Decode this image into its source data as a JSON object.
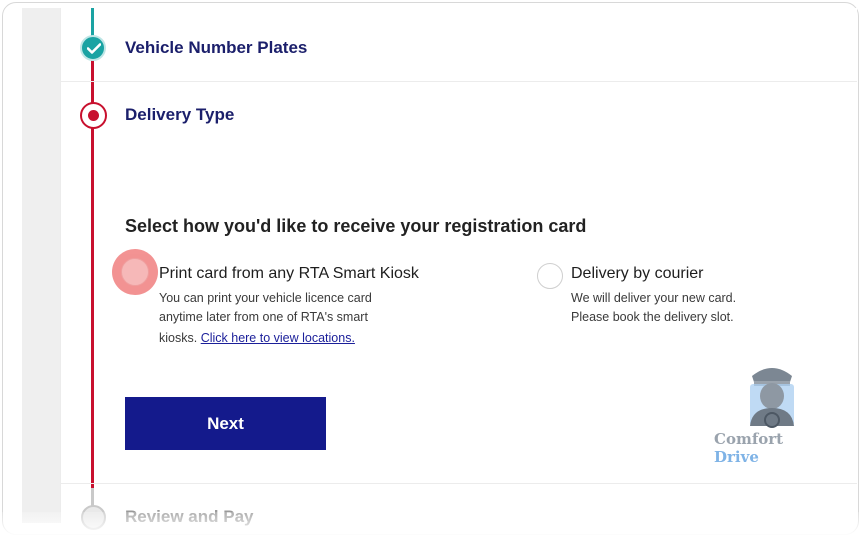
{
  "steps": {
    "completed": {
      "label": "Vehicle Number Plates",
      "icon": "check-icon"
    },
    "current": {
      "label": "Delivery Type"
    },
    "next": {
      "label": "Review and Pay"
    }
  },
  "delivery": {
    "question": "Select how you'd like to receive your registration card",
    "options": [
      {
        "title": "Print card from any RTA Smart Kiosk",
        "desc_line1": "You can print your vehicle licence card",
        "desc_line2": "anytime later from one of RTA's smart",
        "desc_line3": "kiosks.",
        "link": "Click here to view locations.",
        "state": "focused"
      },
      {
        "title": "Delivery by courier",
        "desc_line1": "We will deliver your new card.",
        "desc_line2": "Please book the delivery slot.",
        "state": "unselected"
      }
    ],
    "next_label": "Next"
  },
  "watermark": {
    "word1": "Comfort",
    "word2": "Drive"
  },
  "colors": {
    "accent_navy": "#141a8c",
    "heading_navy": "#1b1f6b",
    "step_done_teal": "#1aa3a3",
    "step_current_red": "#c8102e"
  }
}
